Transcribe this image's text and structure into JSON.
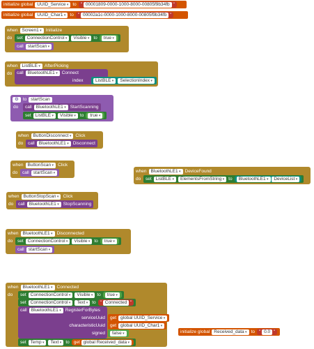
{
  "globals": [
    {
      "init": "initialize global",
      "name": "UUID_Service",
      "to": "to",
      "value": "00001809-0000-1000-8000-00805f9b34fb"
    },
    {
      "init": "initialize global",
      "name": "UUID_Char1",
      "to": "to",
      "value": "00002a1c-0000-1000-8000-00805f9b34fb"
    },
    {
      "init": "initialize global",
      "name": "Received_data",
      "to": "to",
      "value": "0.0"
    }
  ],
  "screen_init": {
    "when": "when",
    "component": "Screen1",
    "event": "Initialize",
    "do": "do",
    "set": "set",
    "target": "ConnectionControl",
    "prop": "Visible",
    "to": "to",
    "value": "true",
    "call": "call",
    "proc": "startScan"
  },
  "listble_after": {
    "when": "when",
    "component": "ListBLE",
    "event": "AfterPicking",
    "do": "do",
    "call": "call",
    "target": "BluetoothLE1",
    "method": "Connect",
    "index": "index",
    "index_src": "ListBLE",
    "index_prop": "SelectionIndex"
  },
  "to_startscan": {
    "to": "to",
    "name": "startScan",
    "do": "do",
    "call": "call",
    "target": "BluetoothLE1",
    "method": "StartScanning",
    "set": "set",
    "set_target": "ListBLE",
    "set_prop": "Visible",
    "set_to": "to",
    "set_value": "true"
  },
  "disconnect_click": {
    "when": "when",
    "component": "ButtonDisconnect",
    "event": "Click",
    "do": "do",
    "call": "call",
    "target": "BluetoothLE1",
    "method": "Disconnect"
  },
  "scan_click": {
    "when": "when",
    "component": "ButtonScan",
    "event": "Click",
    "do": "do",
    "call": "call",
    "proc": "startScan"
  },
  "device_found": {
    "when": "when",
    "component": "BluetoothLE1",
    "event": "DeviceFound",
    "do": "do",
    "set": "set",
    "target": "ListBLE",
    "prop": "ElementsFromString",
    "to": "to",
    "src": "BluetoothLE1",
    "src_prop": "DeviceList"
  },
  "stopscan_click": {
    "when": "when",
    "component": "ButtonStopScan",
    "event": "Click",
    "do": "do",
    "call": "call",
    "target": "BluetoothLE1",
    "method": "StopScanning"
  },
  "disconnected": {
    "when": "when",
    "component": "BluetoothLE1",
    "event": "Disconnected",
    "do": "do",
    "set": "set",
    "target": "ConnectionControl",
    "prop": "Visible",
    "to": "to",
    "value": "true",
    "call": "call",
    "proc": "startScan"
  },
  "connected": {
    "when": "when",
    "component": "BluetoothLE1",
    "event": "Connected",
    "do": "do",
    "set1": "set",
    "t1": "ConnectionControl",
    "p1": "Visible",
    "to1": "to",
    "v1": "true",
    "set2": "set",
    "t2": "ConnectionControl",
    "p2": "Text",
    "to2": "to",
    "v2": "Connected",
    "call": "call",
    "target": "BluetoothLE1",
    "method": "RegisterForBytes",
    "arg1": "serviceUuid",
    "get1": "get",
    "gv1": "global UUID_Service",
    "arg2": "characteristicUuid",
    "get2": "get",
    "gv2": "global UUID_Char1",
    "arg3": "signed",
    "v3": "false",
    "set3": "set",
    "t3": "Temp",
    "p3": "Text",
    "to3": "to",
    "get3": "get",
    "gv3": "global Received_data"
  }
}
